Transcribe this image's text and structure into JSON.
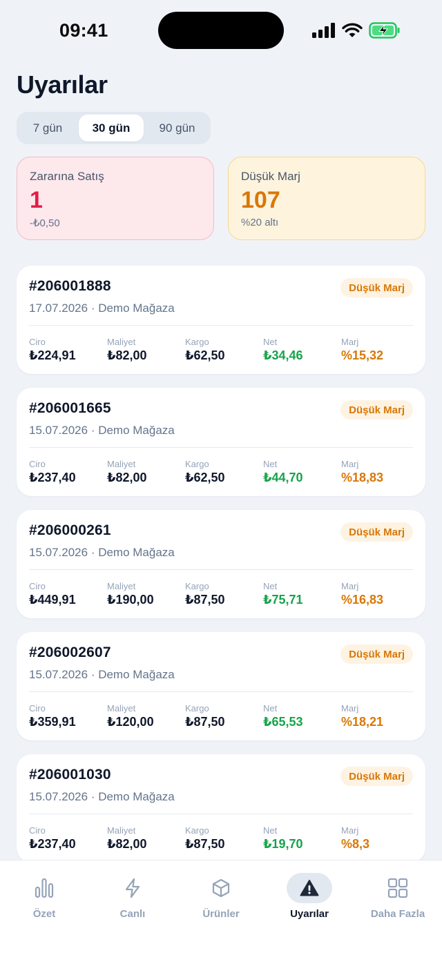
{
  "status_bar": {
    "time": "09:41"
  },
  "page": {
    "title": "Uyarılar"
  },
  "period_filter": {
    "options": [
      "7 gün",
      "30 gün",
      "90 gün"
    ],
    "selected": "30 gün"
  },
  "summary": {
    "loss_sales": {
      "label": "Zararına Satış",
      "value": "1",
      "sub": "-₺0,50"
    },
    "low_margin": {
      "label": "Düşük Marj",
      "value": "107",
      "sub": "%20 altı"
    }
  },
  "metric_labels": {
    "revenue": "Ciro",
    "cost": "Maliyet",
    "shipping": "Kargo",
    "net": "Net",
    "margin": "Marj"
  },
  "orders": [
    {
      "id": "#206001888",
      "date": "17.07.2026",
      "store": "Demo Mağaza",
      "badge": "Düşük Marj",
      "revenue": "₺224,91",
      "cost": "₺82,00",
      "shipping": "₺62,50",
      "net": "₺34,46",
      "margin": "%15,32"
    },
    {
      "id": "#206001665",
      "date": "15.07.2026",
      "store": "Demo Mağaza",
      "badge": "Düşük Marj",
      "revenue": "₺237,40",
      "cost": "₺82,00",
      "shipping": "₺62,50",
      "net": "₺44,70",
      "margin": "%18,83"
    },
    {
      "id": "#206000261",
      "date": "15.07.2026",
      "store": "Demo Mağaza",
      "badge": "Düşük Marj",
      "revenue": "₺449,91",
      "cost": "₺190,00",
      "shipping": "₺87,50",
      "net": "₺75,71",
      "margin": "%16,83"
    },
    {
      "id": "#206002607",
      "date": "15.07.2026",
      "store": "Demo Mağaza",
      "badge": "Düşük Marj",
      "revenue": "₺359,91",
      "cost": "₺120,00",
      "shipping": "₺87,50",
      "net": "₺65,53",
      "margin": "%18,21"
    },
    {
      "id": "#206001030",
      "date": "15.07.2026",
      "store": "Demo Mağaza",
      "badge": "Düşük Marj",
      "revenue": "₺237,40",
      "cost": "₺82,00",
      "shipping": "₺87,50",
      "net": "₺19,70",
      "margin": "%8,3"
    }
  ],
  "tabbar": {
    "items": [
      {
        "label": "Özet",
        "icon": "bar-chart-icon"
      },
      {
        "label": "Canlı",
        "icon": "lightning-icon"
      },
      {
        "label": "Ürünler",
        "icon": "box-icon"
      },
      {
        "label": "Uyarılar",
        "icon": "warning-icon",
        "active": true
      },
      {
        "label": "Daha Fazla",
        "icon": "grid-icon"
      }
    ]
  },
  "colors": {
    "loss": "#e11d48",
    "warning": "#d97706",
    "positive": "#16a34a",
    "text": "#0f172a",
    "muted": "#64748b"
  }
}
